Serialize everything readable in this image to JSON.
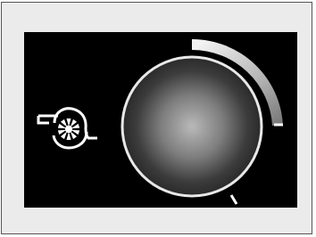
{
  "icons": {
    "fan": "fan-speed-icon",
    "knob": "rotary-dial"
  },
  "fan_speed": {
    "level_fraction": 0.25
  },
  "colors": {
    "frame_background": "#ebebeb",
    "display_background": "#000000",
    "icon_stroke": "#ffffff",
    "knob_ring": "#e8e8e8",
    "knob_center": "#b9b9b9",
    "knob_edge": "#2a2a2a",
    "level_bar_light": "#f2f2f2",
    "level_bar_dark": "#6c6c6c"
  }
}
